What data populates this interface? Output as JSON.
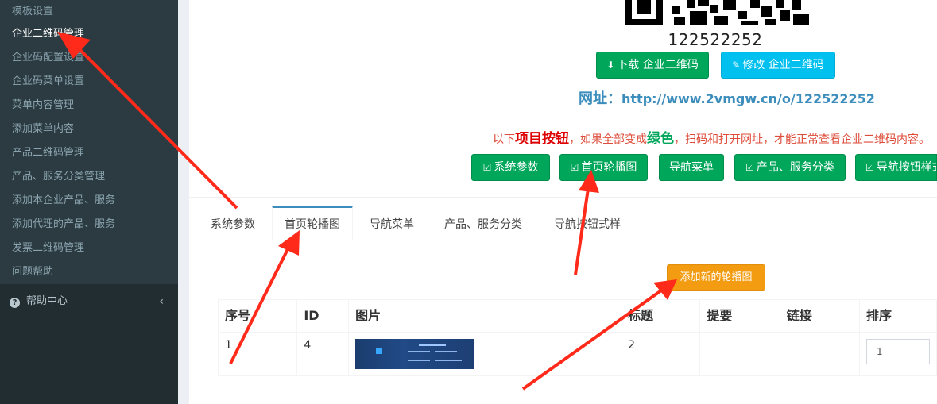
{
  "sidebar": {
    "items": [
      {
        "label": "模板设置",
        "active": false
      },
      {
        "label": "企业二维码管理",
        "active": true
      },
      {
        "label": "企业码配置设置",
        "active": false
      },
      {
        "label": "企业码菜单设置",
        "active": false
      },
      {
        "label": "菜单内容管理",
        "active": false
      },
      {
        "label": "添加菜单内容",
        "active": false
      },
      {
        "label": "产品二维码管理",
        "active": false
      },
      {
        "label": "产品、服务分类管理",
        "active": false
      },
      {
        "label": "添加本企业产品、服务",
        "active": false
      },
      {
        "label": "添加代理的产品、服务",
        "active": false
      },
      {
        "label": "发票二维码管理",
        "active": false
      },
      {
        "label": "问题帮助",
        "active": false
      }
    ],
    "help_center": {
      "label": "帮助中心",
      "icon": "question-circle-icon",
      "chevron": "‹"
    }
  },
  "qr": {
    "number": "122522252"
  },
  "actions": {
    "download_label": "下载 企业二维码",
    "download_icon": "download-icon",
    "edit_label": "修改 企业二维码",
    "edit_icon": "edit-icon"
  },
  "url": {
    "label": "网址：",
    "value": "http://www.2vmgw.cn/o/122522252"
  },
  "notice": {
    "prefix": "以下",
    "highlight": "项目按钮",
    "middle": "，如果全部变成",
    "green_word": "绿色",
    "suffix": "，扫码和打开网址，才能正常查看企业二维码内容。"
  },
  "project_buttons": [
    {
      "label": "系统参数",
      "checked": true
    },
    {
      "label": "首页轮播图",
      "checked": true
    },
    {
      "label": "导航菜单",
      "checked": false
    },
    {
      "label": "产品、服务分类",
      "checked": true
    },
    {
      "label": "导航按钮样式",
      "checked": true
    }
  ],
  "tabs": [
    {
      "label": "系统参数",
      "active": false
    },
    {
      "label": "首页轮播图",
      "active": true
    },
    {
      "label": "导航菜单",
      "active": false
    },
    {
      "label": "产品、服务分类",
      "active": false
    },
    {
      "label": "导航按钮式样",
      "active": false
    }
  ],
  "add_carousel_button": "添加新的轮播图",
  "table": {
    "headers": [
      "序号",
      "ID",
      "图片",
      "标题",
      "提要",
      "链接",
      "排序"
    ],
    "rows": [
      {
        "index": "1",
        "id": "4",
        "image": "banner-thumbnail",
        "title": "2",
        "summary": "",
        "link": "",
        "sort": "1"
      }
    ]
  },
  "colors": {
    "sidebar_bg": "#222d32",
    "submenu_bg": "#2c3b41",
    "green": "#00a65a",
    "cyan": "#00c0ef",
    "orange": "#f39c12",
    "link_blue": "#3c8dbc",
    "annotation_red": "#ff2a1a"
  }
}
